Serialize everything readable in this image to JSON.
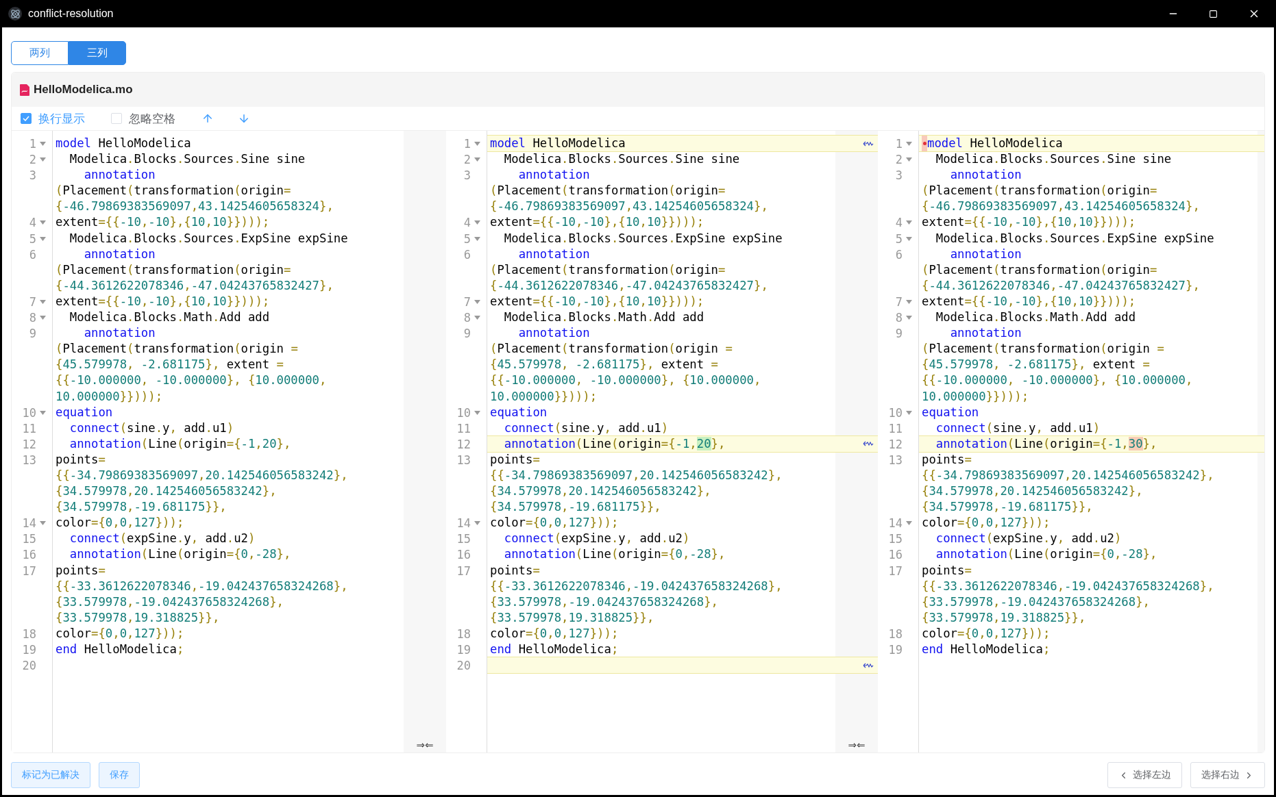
{
  "window": {
    "title": "conflict-resolution"
  },
  "view_tabs": [
    {
      "label": "两列",
      "selected": false
    },
    {
      "label": "三列",
      "selected": true
    }
  ],
  "file": {
    "name": "HelloModelica.mo"
  },
  "options": [
    {
      "label": "换行显示",
      "checked": true
    },
    {
      "label": "忽略空格",
      "checked": false
    }
  ],
  "panes": [
    {
      "gap_label": "⇒⇐",
      "lines": [
        {
          "number": "1",
          "fold": true,
          "changed": false,
          "segments": [
            {
              "kind": "keyword",
              "text": "model "
            },
            {
              "kind": "code",
              "text": "HelloModelica"
            }
          ]
        },
        {
          "number": "2",
          "fold": true,
          "changed": false,
          "segments": [
            {
              "kind": "code",
              "text": "  Modelica.Blocks.Sources.Sine sine"
            }
          ]
        },
        {
          "number": "3",
          "fold": false,
          "changed": false,
          "segments": [
            {
              "kind": "keyword",
              "text": "    annotation "
            },
            {
              "kind": "code",
              "text": "(Placement(transformation(origin= "
            },
            {
              "kind": "code",
              "text": "{-46.79869383569097,43.14254605658324},"
            }
          ]
        },
        {
          "number": "4",
          "fold": true,
          "changed": false,
          "segments": [
            {
              "kind": "code",
              "text": "extent={{-10,-10},{10,10}})));"
            }
          ]
        },
        {
          "number": "5",
          "fold": true,
          "changed": false,
          "segments": [
            {
              "kind": "code",
              "text": "  Modelica.Blocks.Sources.ExpSine expSine"
            }
          ]
        },
        {
          "number": "6",
          "fold": false,
          "changed": false,
          "segments": [
            {
              "kind": "keyword",
              "text": "    annotation "
            },
            {
              "kind": "code",
              "text": "(Placement(transformation(origin= "
            },
            {
              "kind": "code",
              "text": "{-44.3612622078346,-47.04243765832427},"
            }
          ]
        },
        {
          "number": "7",
          "fold": true,
          "changed": false,
          "segments": [
            {
              "kind": "code",
              "text": "extent={{-10,-10},{10,10}})));"
            }
          ]
        },
        {
          "number": "8",
          "fold": true,
          "changed": false,
          "segments": [
            {
              "kind": "code",
              "text": "  Modelica.Blocks.Math.Add add"
            }
          ]
        },
        {
          "number": "9",
          "fold": false,
          "changed": false,
          "segments": [
            {
              "kind": "keyword",
              "text": "    annotation "
            },
            {
              "kind": "code",
              "text": "(Placement(transformation(origin = {45.579978, -2.681175}, extent = {{-10.000000, -10.000000}, {10.000000, 10.000000}})));"
            }
          ]
        },
        {
          "number": "10",
          "fold": true,
          "changed": false,
          "segments": [
            {
              "kind": "keyword",
              "text": "equation"
            }
          ]
        },
        {
          "number": "11",
          "fold": false,
          "changed": false,
          "segments": [
            {
              "kind": "keyword",
              "text": "  connect"
            },
            {
              "kind": "code",
              "text": "(sine.y, add.u1)"
            }
          ]
        },
        {
          "number": "12",
          "fold": false,
          "changed": false,
          "segments": [
            {
              "kind": "keyword",
              "text": "  annotation"
            },
            {
              "kind": "code",
              "text": "(Line(origin={-1,20},"
            }
          ]
        },
        {
          "number": "13",
          "fold": false,
          "changed": false,
          "segments": [
            {
              "kind": "code",
              "text": "points= {{-34.79869383569097,20.142546056583242}, {34.579978,20.142546056583242}, {34.579978,-19.681175}},"
            }
          ]
        },
        {
          "number": "14",
          "fold": true,
          "changed": false,
          "segments": [
            {
              "kind": "code",
              "text": "color={0,0,127}));"
            }
          ]
        },
        {
          "number": "15",
          "fold": false,
          "changed": false,
          "segments": [
            {
              "kind": "keyword",
              "text": "  connect"
            },
            {
              "kind": "code",
              "text": "(expSine.y, add.u2)"
            }
          ]
        },
        {
          "number": "16",
          "fold": false,
          "changed": false,
          "segments": [
            {
              "kind": "keyword",
              "text": "  annotation"
            },
            {
              "kind": "code",
              "text": "(Line(origin={0,-28},"
            }
          ]
        },
        {
          "number": "17",
          "fold": false,
          "changed": false,
          "segments": [
            {
              "kind": "code",
              "text": "points= {{-33.3612622078346,-19.042437658324268}, {33.579978,-19.042437658324268}, {33.579978,19.318825}},"
            }
          ]
        },
        {
          "number": "18",
          "fold": false,
          "changed": false,
          "segments": [
            {
              "kind": "code",
              "text": "color={0,0,127}));"
            }
          ]
        },
        {
          "number": "19",
          "fold": false,
          "changed": false,
          "segments": [
            {
              "kind": "keyword",
              "text": "end "
            },
            {
              "kind": "code",
              "text": "HelloModelica;"
            }
          ]
        },
        {
          "number": "20",
          "fold": false,
          "changed": false
        }
      ]
    },
    {
      "gap_label": "⇒⇐",
      "lines": [
        {
          "number": "1",
          "fold": true,
          "changed": true,
          "segments": [
            {
              "kind": "keyword",
              "text": "model "
            },
            {
              "kind": "code",
              "text": "HelloModelica"
            }
          ]
        },
        {
          "number": "2",
          "fold": true,
          "changed": false,
          "segments": [
            {
              "kind": "code",
              "text": "  Modelica.Blocks.Sources.Sine sine"
            }
          ]
        },
        {
          "number": "3",
          "fold": false,
          "changed": false,
          "segments": [
            {
              "kind": "keyword",
              "text": "    annotation "
            },
            {
              "kind": "code",
              "text": "(Placement(transformation(origin= "
            },
            {
              "kind": "code",
              "text": "{-46.79869383569097,43.14254605658324},"
            }
          ]
        },
        {
          "number": "4",
          "fold": true,
          "changed": false,
          "segments": [
            {
              "kind": "code",
              "text": "extent={{-10,-10},{10,10}})));"
            }
          ]
        },
        {
          "number": "5",
          "fold": true,
          "changed": false,
          "segments": [
            {
              "kind": "code",
              "text": "  Modelica.Blocks.Sources.ExpSine expSine"
            }
          ]
        },
        {
          "number": "6",
          "fold": false,
          "changed": false,
          "segments": [
            {
              "kind": "keyword",
              "text": "    annotation "
            },
            {
              "kind": "code",
              "text": "(Placement(transformation(origin= "
            },
            {
              "kind": "code",
              "text": "{-44.3612622078346,-47.04243765832427},"
            }
          ]
        },
        {
          "number": "7",
          "fold": true,
          "changed": false,
          "segments": [
            {
              "kind": "code",
              "text": "extent={{-10,-10},{10,10}})));"
            }
          ]
        },
        {
          "number": "8",
          "fold": true,
          "changed": false,
          "segments": [
            {
              "kind": "code",
              "text": "  Modelica.Blocks.Math.Add add"
            }
          ]
        },
        {
          "number": "9",
          "fold": false,
          "changed": false,
          "segments": [
            {
              "kind": "keyword",
              "text": "    annotation "
            },
            {
              "kind": "code",
              "text": "(Placement(transformation(origin = {45.579978, -2.681175}, extent = {{-10.000000, -10.000000}, {10.000000, 10.000000}})));"
            }
          ]
        },
        {
          "number": "10",
          "fold": true,
          "changed": false,
          "segments": [
            {
              "kind": "keyword",
              "text": "equation"
            }
          ]
        },
        {
          "number": "11",
          "fold": false,
          "changed": false,
          "segments": [
            {
              "kind": "keyword",
              "text": "  connect"
            },
            {
              "kind": "code",
              "text": "(sine.y, add.u1)"
            }
          ]
        },
        {
          "number": "12",
          "fold": false,
          "changed": true,
          "segments": [
            {
              "kind": "keyword",
              "text": "  annotation"
            },
            {
              "kind": "code",
              "text": "(Line(origin={-1,"
            },
            {
              "kind": "added",
              "text": "20"
            },
            {
              "kind": "code",
              "text": "},"
            }
          ]
        },
        {
          "number": "13",
          "fold": false,
          "changed": false,
          "segments": [
            {
              "kind": "code",
              "text": "points= {{-34.79869383569097,20.142546056583242}, {34.579978,20.142546056583242}, {34.579978,-19.681175}},"
            }
          ]
        },
        {
          "number": "14",
          "fold": true,
          "changed": false,
          "segments": [
            {
              "kind": "code",
              "text": "color={0,0,127}));"
            }
          ]
        },
        {
          "number": "15",
          "fold": false,
          "changed": false,
          "segments": [
            {
              "kind": "keyword",
              "text": "  connect"
            },
            {
              "kind": "code",
              "text": "(expSine.y, add.u2)"
            }
          ]
        },
        {
          "number": "16",
          "fold": false,
          "changed": false,
          "segments": [
            {
              "kind": "keyword",
              "text": "  annotation"
            },
            {
              "kind": "code",
              "text": "(Line(origin={0,-28},"
            }
          ]
        },
        {
          "number": "17",
          "fold": false,
          "changed": false,
          "segments": [
            {
              "kind": "code",
              "text": "points= {{-33.3612622078346,-19.042437658324268}, {33.579978,-19.042437658324268}, {33.579978,19.318825}},"
            }
          ]
        },
        {
          "number": "18",
          "fold": false,
          "changed": false,
          "segments": [
            {
              "kind": "code",
              "text": "color={0,0,127}));"
            }
          ]
        },
        {
          "number": "19",
          "fold": false,
          "changed": false,
          "segments": [
            {
              "kind": "keyword",
              "text": "end "
            },
            {
              "kind": "code",
              "text": "HelloModelica;"
            }
          ]
        },
        {
          "number": "20",
          "fold": false,
          "changed": true
        }
      ]
    },
    {
      "lines": [
        {
          "number": "1",
          "fold": true,
          "changed": true,
          "marker": true,
          "segments": [
            {
              "kind": "keyword",
              "text": "model "
            },
            {
              "kind": "code",
              "text": "HelloModelica"
            }
          ]
        },
        {
          "number": "2",
          "fold": true,
          "changed": false,
          "segments": [
            {
              "kind": "code",
              "text": "  Modelica.Blocks.Sources.Sine sine"
            }
          ]
        },
        {
          "number": "3",
          "fold": false,
          "changed": false,
          "segments": [
            {
              "kind": "keyword",
              "text": "    annotation "
            },
            {
              "kind": "code",
              "text": "(Placement(transformation(origin= "
            },
            {
              "kind": "code",
              "text": "{-46.79869383569097,43.14254605658324},"
            }
          ]
        },
        {
          "number": "4",
          "fold": true,
          "changed": false,
          "segments": [
            {
              "kind": "code",
              "text": "extent={{-10,-10},{10,10}})));"
            }
          ]
        },
        {
          "number": "5",
          "fold": true,
          "changed": false,
          "segments": [
            {
              "kind": "code",
              "text": "  Modelica.Blocks.Sources.ExpSine expSine"
            }
          ]
        },
        {
          "number": "6",
          "fold": false,
          "changed": false,
          "segments": [
            {
              "kind": "keyword",
              "text": "    annotation "
            },
            {
              "kind": "code",
              "text": "(Placement(transformation(origin= "
            },
            {
              "kind": "code",
              "text": "{-44.3612622078346,-47.04243765832427},"
            }
          ]
        },
        {
          "number": "7",
          "fold": true,
          "changed": false,
          "segments": [
            {
              "kind": "code",
              "text": "extent={{-10,-10},{10,10}})));"
            }
          ]
        },
        {
          "number": "8",
          "fold": true,
          "changed": false,
          "segments": [
            {
              "kind": "code",
              "text": "  Modelica.Blocks.Math.Add add"
            }
          ]
        },
        {
          "number": "9",
          "fold": false,
          "changed": false,
          "segments": [
            {
              "kind": "keyword",
              "text": "    annotation "
            },
            {
              "kind": "code",
              "text": "(Placement(transformation(origin = {45.579978, -2.681175}, extent = {{-10.000000, -10.000000}, {10.000000, 10.000000}})));"
            }
          ]
        },
        {
          "number": "10",
          "fold": true,
          "changed": false,
          "segments": [
            {
              "kind": "keyword",
              "text": "equation"
            }
          ]
        },
        {
          "number": "11",
          "fold": false,
          "changed": false,
          "segments": [
            {
              "kind": "keyword",
              "text": "  connect"
            },
            {
              "kind": "code",
              "text": "(sine.y, add.u1)"
            }
          ]
        },
        {
          "number": "12",
          "fold": false,
          "changed": true,
          "segments": [
            {
              "kind": "keyword",
              "text": "  annotation"
            },
            {
              "kind": "code",
              "text": "(Line(origin={-1,"
            },
            {
              "kind": "removed",
              "text": "30"
            },
            {
              "kind": "code",
              "text": "},"
            }
          ]
        },
        {
          "number": "13",
          "fold": false,
          "changed": false,
          "segments": [
            {
              "kind": "code",
              "text": "points= {{-34.79869383569097,20.142546056583242}, {34.579978,20.142546056583242}, {34.579978,-19.681175}},"
            }
          ]
        },
        {
          "number": "14",
          "fold": true,
          "changed": false,
          "segments": [
            {
              "kind": "code",
              "text": "color={0,0,127}));"
            }
          ]
        },
        {
          "number": "15",
          "fold": false,
          "changed": false,
          "segments": [
            {
              "kind": "keyword",
              "text": "  connect"
            },
            {
              "kind": "code",
              "text": "(expSine.y, add.u2)"
            }
          ]
        },
        {
          "number": "16",
          "fold": false,
          "changed": false,
          "segments": [
            {
              "kind": "keyword",
              "text": "  annotation"
            },
            {
              "kind": "code",
              "text": "(Line(origin={0,-28},"
            }
          ]
        },
        {
          "number": "17",
          "fold": false,
          "changed": false,
          "segments": [
            {
              "kind": "code",
              "text": "points= {{-33.3612622078346,-19.042437658324268}, {33.579978,-19.042437658324268}, {33.579978,19.318825}},"
            }
          ]
        },
        {
          "number": "18",
          "fold": false,
          "changed": false,
          "segments": [
            {
              "kind": "code",
              "text": "color={0,0,127}));"
            }
          ]
        },
        {
          "number": "19",
          "fold": false,
          "changed": false,
          "segments": [
            {
              "kind": "keyword",
              "text": "end "
            },
            {
              "kind": "code",
              "text": "HelloModelica;"
            }
          ]
        }
      ]
    }
  ],
  "footer": {
    "start": [
      {
        "label": "标记为已解决"
      },
      {
        "label": "保存"
      }
    ],
    "end": [
      {
        "label": "选择左边",
        "chevron_left": true,
        "chevron_right": false
      },
      {
        "label": "选择右边",
        "chevron_left": false,
        "chevron_right": true
      }
    ]
  }
}
